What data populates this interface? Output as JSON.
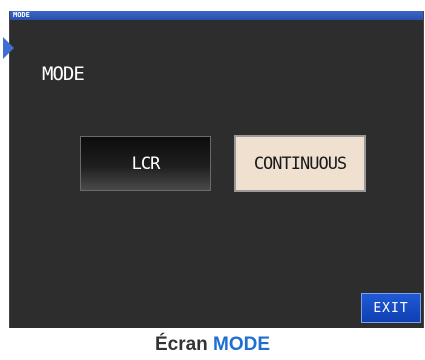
{
  "window": {
    "title": "MODE"
  },
  "screen": {
    "heading": "MODE"
  },
  "mode_buttons": {
    "lcr_label": "LCR",
    "continuous_label": "CONTINUOUS",
    "selected": "CONTINUOUS"
  },
  "footer": {
    "exit_label": "EXIT"
  },
  "caption": {
    "prefix": "Écran ",
    "highlight": "MODE"
  },
  "colors": {
    "titlebar": "#2a4fae",
    "screen_background": "#2d2d2d",
    "selected_button": "#efe0d0",
    "exit_button": "#1f5bd6",
    "caption_accent": "#1f6fd1"
  }
}
